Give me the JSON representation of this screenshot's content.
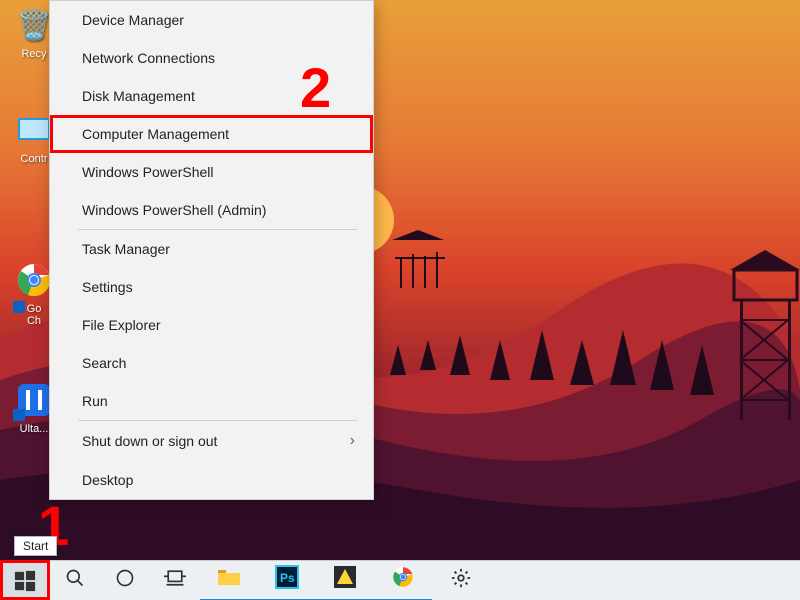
{
  "desktop_icons": {
    "recycle": "Recy",
    "control": "Contr",
    "chrome_l1": "Go",
    "chrome_l2": "Ch",
    "ultra": "Ulta..."
  },
  "context_menu": {
    "device_manager": "Device Manager",
    "network_connections": "Network Connections",
    "disk_management": "Disk Management",
    "computer_management": "Computer Management",
    "powershell": "Windows PowerShell",
    "powershell_admin": "Windows PowerShell (Admin)",
    "task_manager": "Task Manager",
    "settings": "Settings",
    "file_explorer": "File Explorer",
    "search": "Search",
    "run": "Run",
    "shutdown": "Shut down or sign out",
    "desktop": "Desktop"
  },
  "tooltip": {
    "start": "Start"
  },
  "callouts": {
    "one": "1",
    "two": "2"
  }
}
